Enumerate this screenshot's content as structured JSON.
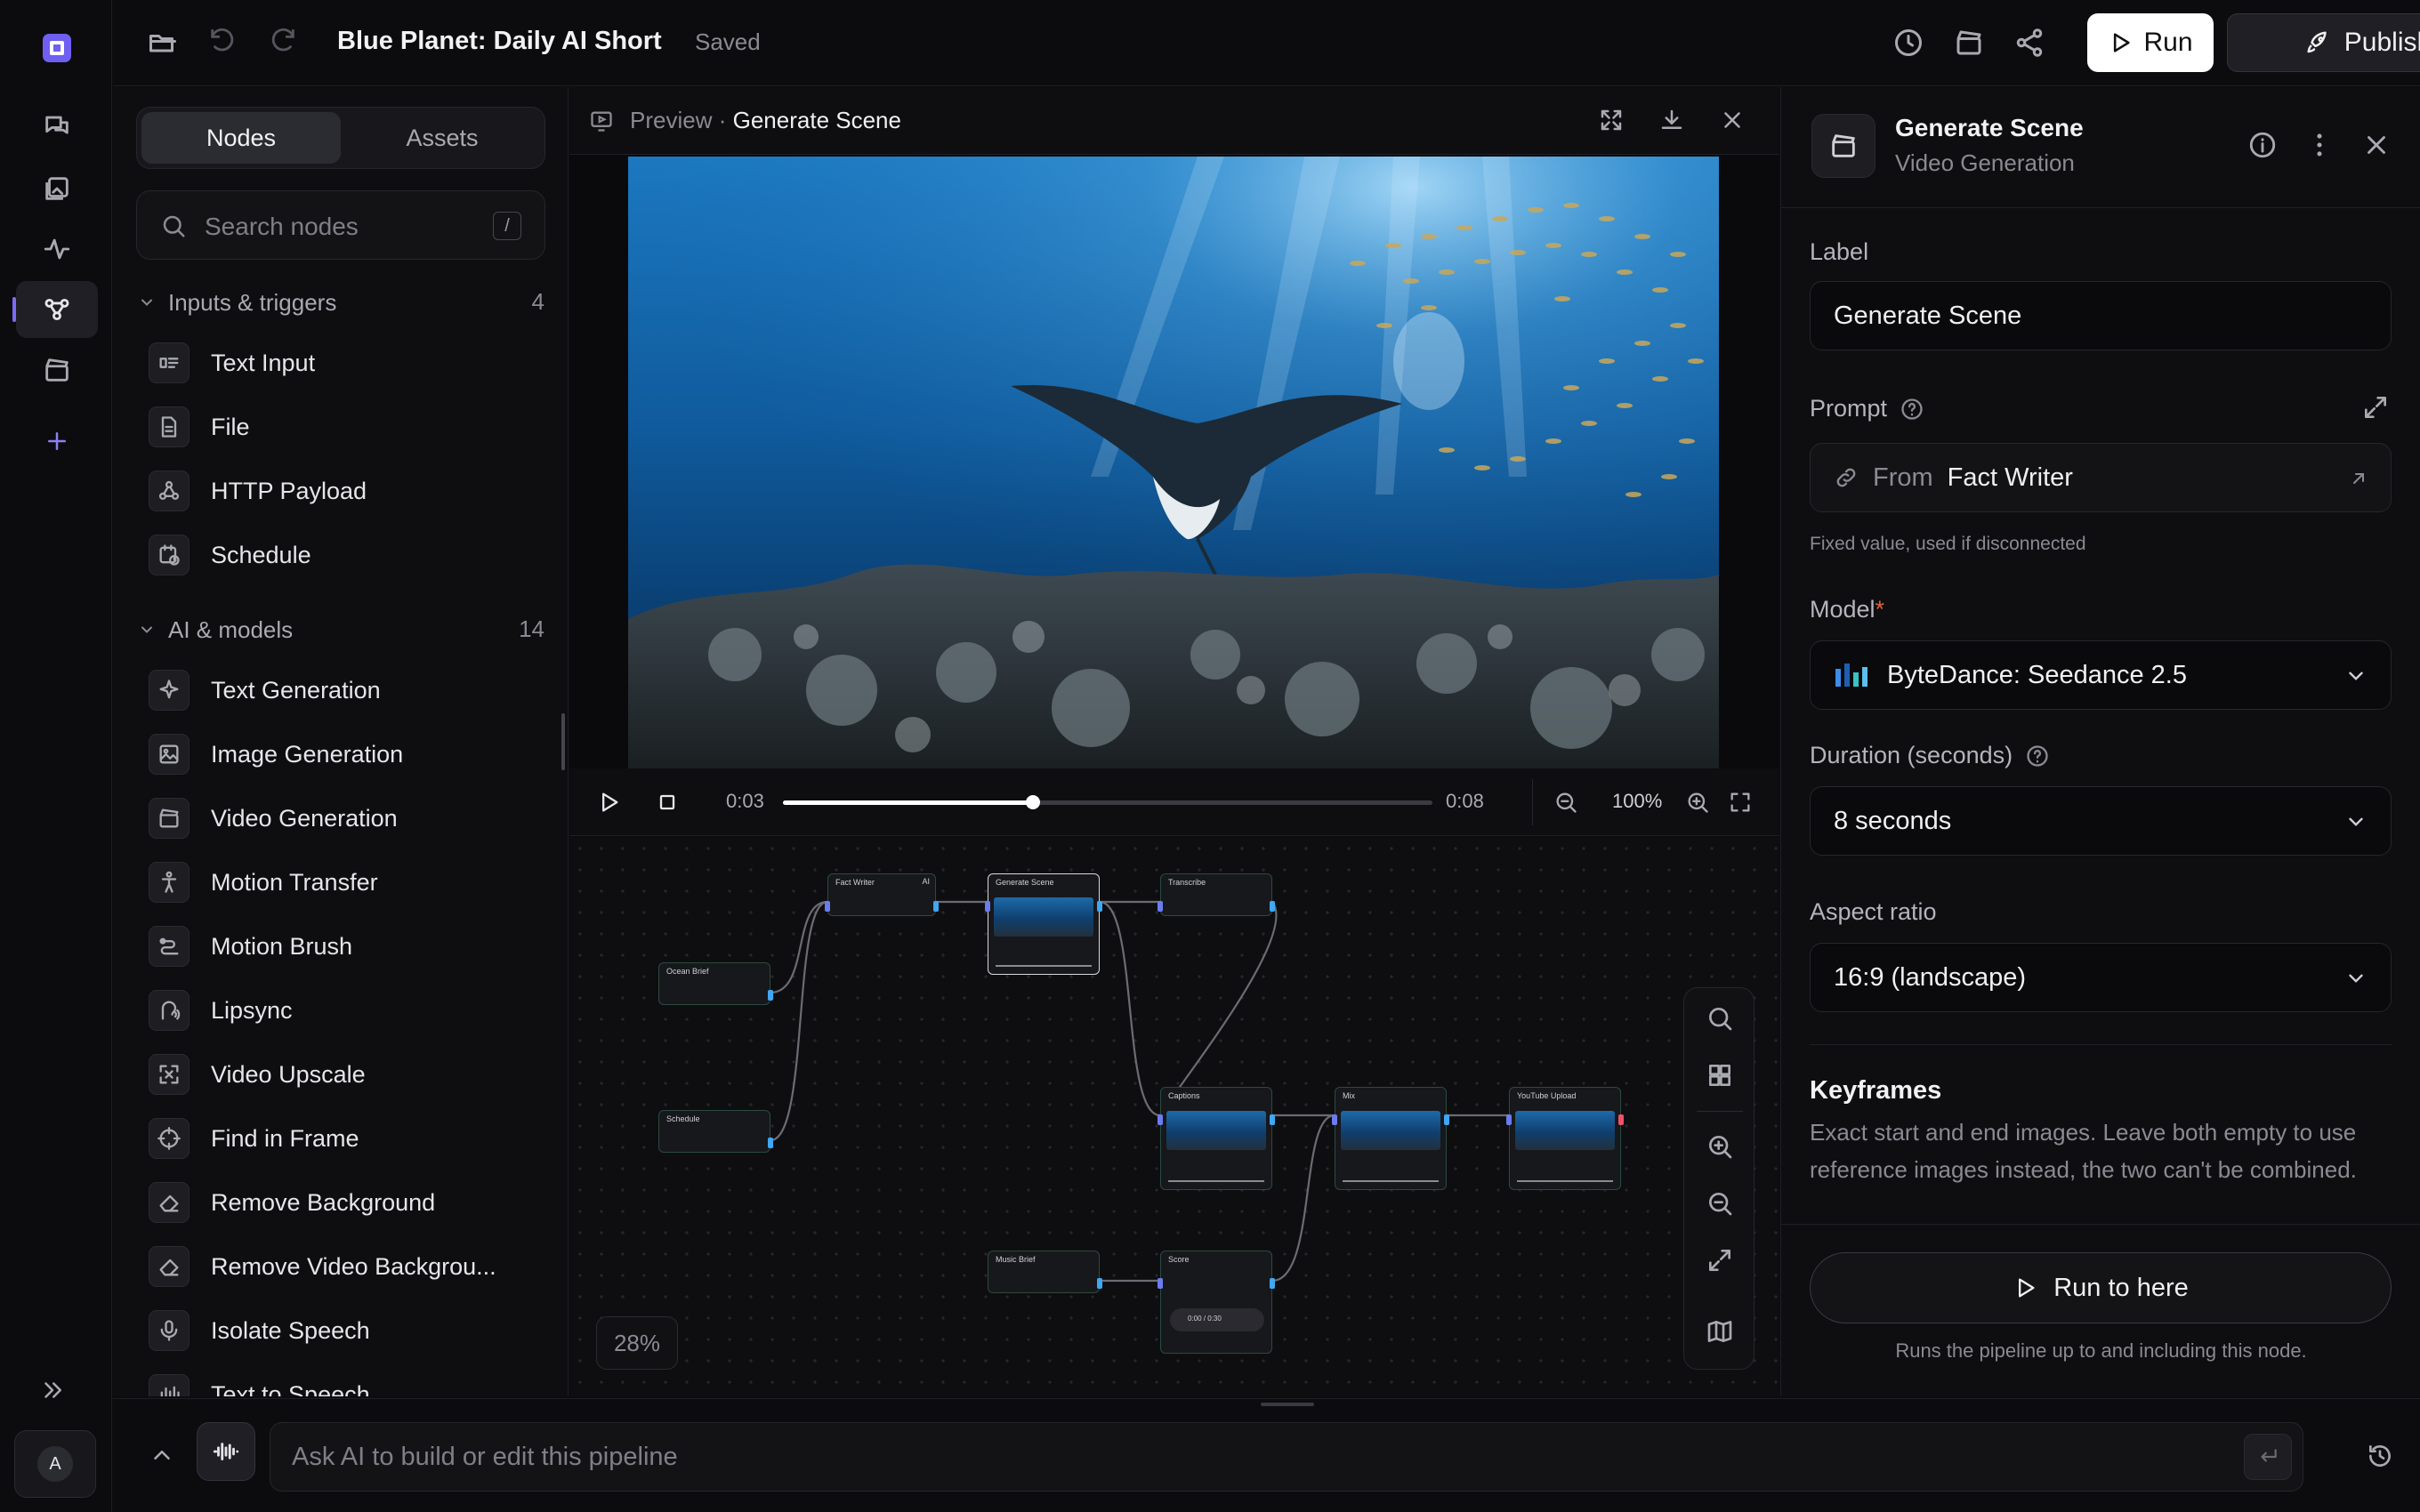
{
  "app": {
    "title": "Blue Planet: Daily AI Short",
    "status": "Saved",
    "run_label": "Run",
    "publish_label": "Publish",
    "accent": "#7b6cf6"
  },
  "left_panel": {
    "tabs": [
      {
        "label": "Nodes",
        "active": true
      },
      {
        "label": "Assets",
        "active": false
      }
    ],
    "search": {
      "placeholder": "Search nodes",
      "shortcut": "/"
    },
    "groups": [
      {
        "title": "Inputs & triggers",
        "count": "4",
        "items": [
          {
            "label": "Text Input",
            "icon": "text-input-icon"
          },
          {
            "label": "File",
            "icon": "file-icon"
          },
          {
            "label": "HTTP Payload",
            "icon": "webhook-icon"
          },
          {
            "label": "Schedule",
            "icon": "calendar-clock-icon"
          }
        ]
      },
      {
        "title": "AI & models",
        "count": "14",
        "items": [
          {
            "label": "Text Generation",
            "icon": "sparkles-icon"
          },
          {
            "label": "Image Generation",
            "icon": "image-icon"
          },
          {
            "label": "Video Generation",
            "icon": "clapperboard-icon"
          },
          {
            "label": "Motion Transfer",
            "icon": "person-motion-icon"
          },
          {
            "label": "Motion Brush",
            "icon": "brush-icon"
          },
          {
            "label": "Lipsync",
            "icon": "lipsync-icon"
          },
          {
            "label": "Video Upscale",
            "icon": "upscale-icon"
          },
          {
            "label": "Find in Frame",
            "icon": "target-icon"
          },
          {
            "label": "Remove Background",
            "icon": "eraser-icon"
          },
          {
            "label": "Remove Video Backgrou...",
            "icon": "eraser-icon"
          },
          {
            "label": "Isolate Speech",
            "icon": "mic-icon"
          },
          {
            "label": "Text to Speech",
            "icon": "audio-lines-icon"
          }
        ]
      }
    ]
  },
  "preview": {
    "crumb_prefix": "Preview",
    "crumb_sep": "·",
    "node_name": "Generate Scene",
    "current_time": "0:03",
    "duration": "0:08",
    "progress": 0.385,
    "zoom": "100%"
  },
  "canvas": {
    "zoom": "28%",
    "nodes": [
      {
        "label": "Fact Writer",
        "badge": "AI"
      },
      {
        "label": "Generate Scene"
      },
      {
        "label": "Transcribe"
      },
      {
        "label": "Ocean Brief"
      },
      {
        "label": "Schedule"
      },
      {
        "label": "Captions"
      },
      {
        "label": "Mix"
      },
      {
        "label": "YouTube Upload"
      },
      {
        "label": "Music Brief"
      },
      {
        "label": "Score",
        "audio_time": "0:00 / 0:30"
      }
    ]
  },
  "inspector": {
    "title": "Generate Scene",
    "subtitle": "Video Generation",
    "label_field": {
      "label": "Label",
      "value": "Generate Scene"
    },
    "prompt": {
      "label": "Prompt",
      "from": "From",
      "source": "Fact Writer",
      "hint": "Fixed value, used if disconnected"
    },
    "model": {
      "label": "Model",
      "required": "*",
      "value": "ByteDance: Seedance 2.5"
    },
    "duration": {
      "label": "Duration (seconds)",
      "value": "8 seconds"
    },
    "aspect": {
      "label": "Aspect ratio",
      "value": "16:9 (landscape)"
    },
    "keyframes": {
      "title": "Keyframes",
      "description": "Exact start and end images. Leave both empty to use reference images instead, the two can't be combined."
    },
    "run_to_here": {
      "label": "Run to here",
      "hint": "Runs the pipeline up to and including this node."
    }
  },
  "chat": {
    "placeholder": "Ask AI to build or edit this pipeline"
  },
  "user": {
    "initial": "A"
  }
}
